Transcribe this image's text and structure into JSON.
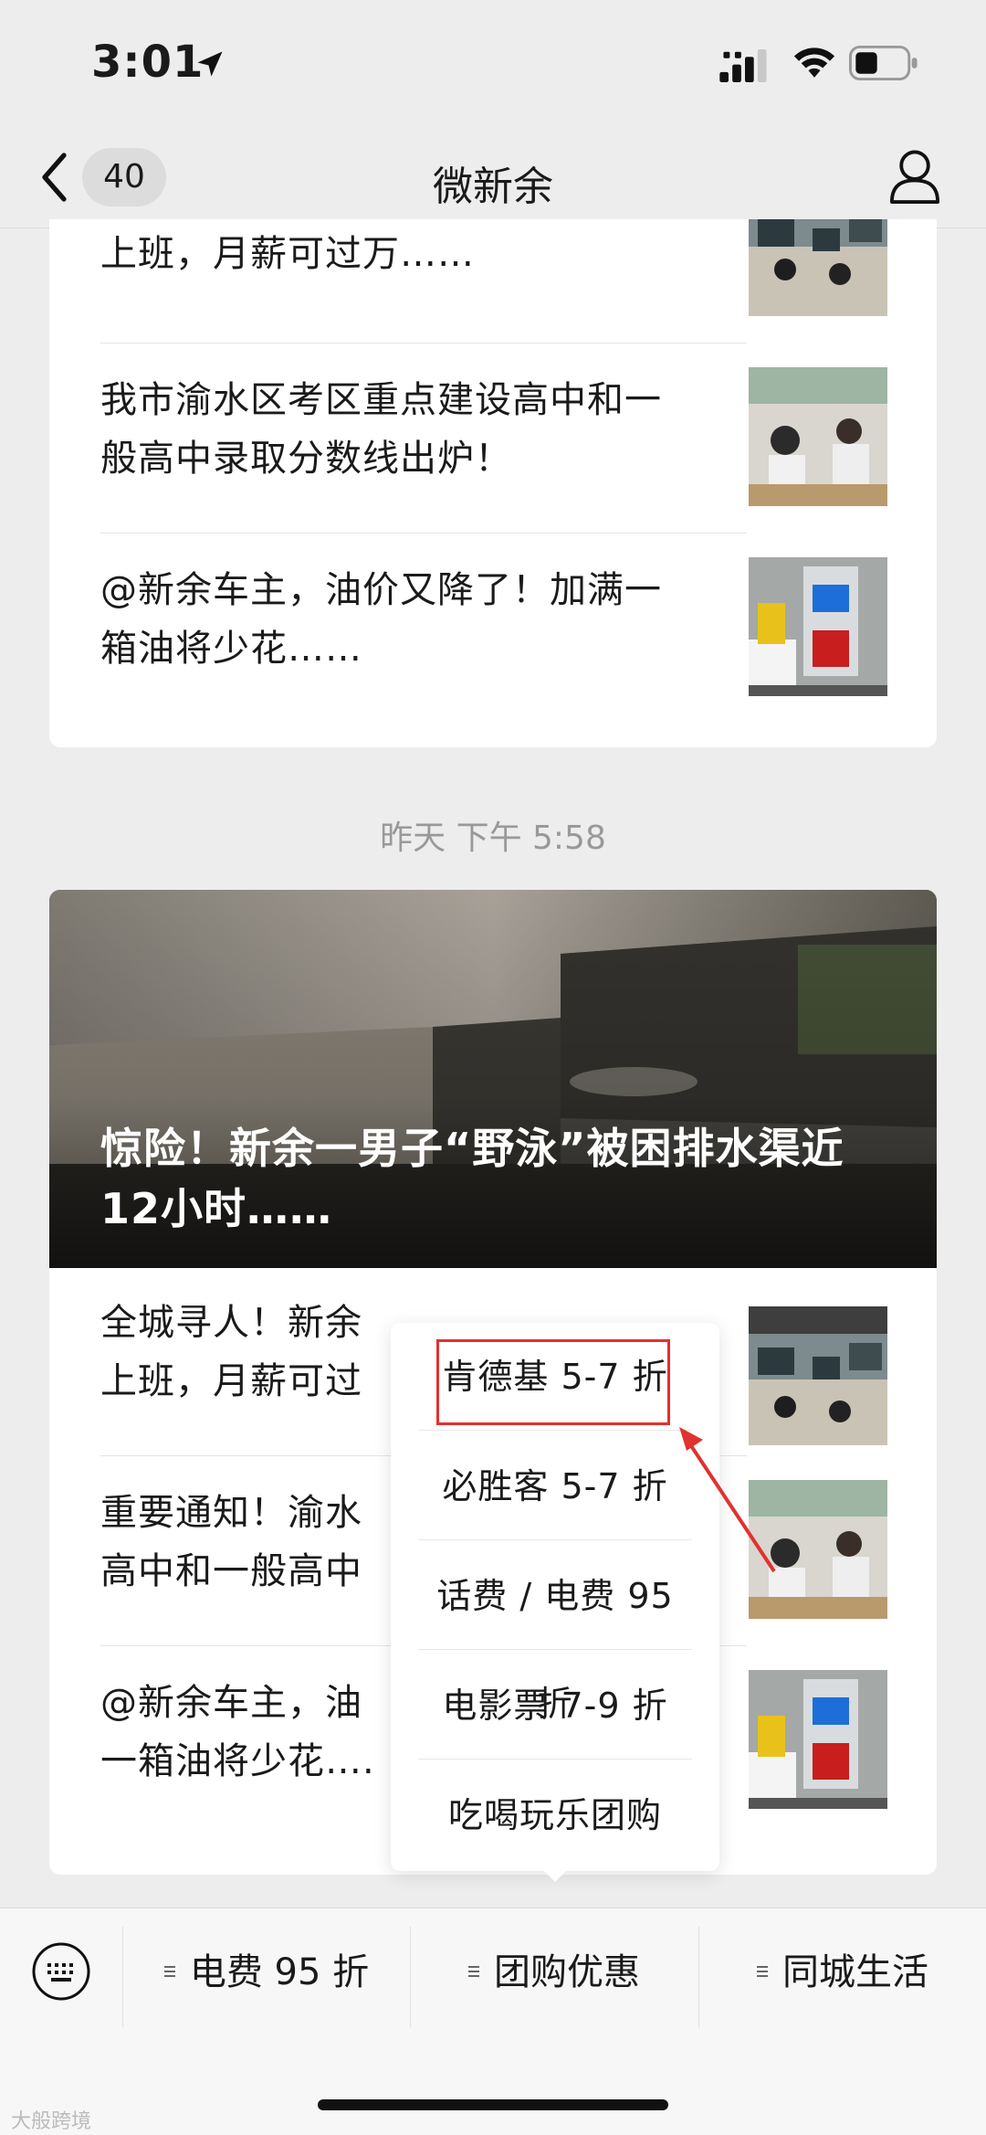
{
  "status_bar": {
    "time": "3:01"
  },
  "nav": {
    "badge": "40",
    "title": "微新余"
  },
  "card1": {
    "items": [
      {
        "text": "上班，月薪可过万……"
      },
      {
        "text": "我市渝水区考区重点建设高中和一般高中录取分数线出炉！"
      },
      {
        "text": "@新余车主，油价又降了！加满一箱油将少花……"
      }
    ]
  },
  "timestamp": "昨天 下午 5:58",
  "card2": {
    "cover_title": "惊险！新余一男子“野泳”被困排水渠近12小时……",
    "items": [
      {
        "text": "全城寻人！新余"
      },
      {
        "text": "上班，月薪可过"
      },
      {
        "text": "重要通知！渝水"
      },
      {
        "text": "高中和一般高中"
      },
      {
        "text": "@新余车主，油"
      },
      {
        "text": "一箱油将少花…."
      }
    ]
  },
  "popup": {
    "items": [
      "肯德基 5-7 折",
      "必胜客 5-7 折",
      "话费 / 电费 95 折",
      "电影票 7-9 折",
      "吃喝玩乐团购"
    ]
  },
  "menu_bar": {
    "items": [
      "电费 95 折",
      "团购优惠",
      "同城生活"
    ]
  },
  "watermark": "大般跨境",
  "colors": {
    "highlight": "#e0322f",
    "background": "#ededed"
  },
  "icons": [
    "location-arrow-icon",
    "signal-icon",
    "wifi-icon",
    "battery-icon",
    "back-icon",
    "profile-icon",
    "keyboard-icon",
    "menu-lines-icon"
  ]
}
